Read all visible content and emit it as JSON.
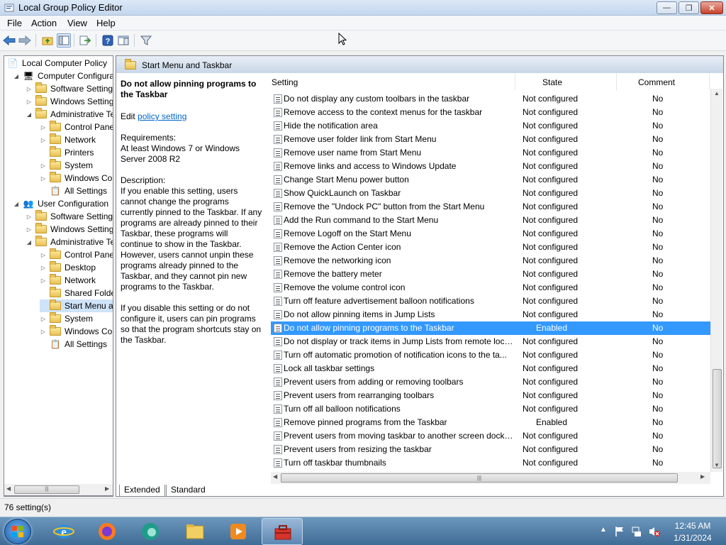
{
  "window": {
    "title": "Local Group Policy Editor"
  },
  "menu": [
    "File",
    "Action",
    "View",
    "Help"
  ],
  "tree": [
    {
      "label": "Local Computer Policy",
      "level": 0
    },
    {
      "label": "Computer Configura",
      "level": 1
    },
    {
      "label": "Software Settings",
      "level": 2
    },
    {
      "label": "Windows Setting",
      "level": 2
    },
    {
      "label": "Administrative Te",
      "level": 2
    },
    {
      "label": "Control Panel",
      "level": 3
    },
    {
      "label": "Network",
      "level": 3
    },
    {
      "label": "Printers",
      "level": 3
    },
    {
      "label": "System",
      "level": 3
    },
    {
      "label": "Windows Cor",
      "level": 3
    },
    {
      "label": "All Settings",
      "level": 3
    },
    {
      "label": "User Configuration",
      "level": 1
    },
    {
      "label": "Software Settings",
      "level": 2
    },
    {
      "label": "Windows Setting",
      "level": 2
    },
    {
      "label": "Administrative Te",
      "level": 2
    },
    {
      "label": "Control Panel",
      "level": 3
    },
    {
      "label": "Desktop",
      "level": 3
    },
    {
      "label": "Network",
      "level": 3
    },
    {
      "label": "Shared Folder",
      "level": 3
    },
    {
      "label": "Start Menu ar",
      "level": 3
    },
    {
      "label": "System",
      "level": 3
    },
    {
      "label": "Windows Cor",
      "level": 3
    },
    {
      "label": "All Settings",
      "level": 3
    }
  ],
  "main": {
    "header": "Start Menu and Taskbar",
    "description": {
      "title": "Do not allow pinning programs to the Taskbar",
      "edit_prefix": "Edit",
      "edit_link": "policy setting",
      "requirements_label": "Requirements:",
      "requirements": "At least Windows 7 or Windows Server 2008 R2",
      "description_label": "Description:",
      "p1": "If you enable this setting, users cannot change the programs currently pinned to the Taskbar. If any programs are already pinned to their Taskbar, these programs will continue to show in the Taskbar. However, users cannot unpin these programs already pinned to the Taskbar, and they cannot pin new programs to the Taskbar.",
      "p2": "If you disable this setting or do not configure it, users can pin programs so that the program shortcuts stay on the Taskbar."
    },
    "columns": {
      "setting": "Setting",
      "state": "State",
      "comment": "Comment"
    },
    "rows": [
      {
        "name": "Do not display any custom toolbars in the taskbar",
        "state": "Not configured",
        "comment": "No"
      },
      {
        "name": "Remove access to the context menus for the taskbar",
        "state": "Not configured",
        "comment": "No"
      },
      {
        "name": "Hide the notification area",
        "state": "Not configured",
        "comment": "No"
      },
      {
        "name": "Remove user folder link from Start Menu",
        "state": "Not configured",
        "comment": "No"
      },
      {
        "name": "Remove user name from Start Menu",
        "state": "Not configured",
        "comment": "No"
      },
      {
        "name": "Remove links and access to Windows Update",
        "state": "Not configured",
        "comment": "No"
      },
      {
        "name": "Change Start Menu power button",
        "state": "Not configured",
        "comment": "No"
      },
      {
        "name": "Show QuickLaunch on Taskbar",
        "state": "Not configured",
        "comment": "No"
      },
      {
        "name": "Remove the \"Undock PC\" button from the Start Menu",
        "state": "Not configured",
        "comment": "No"
      },
      {
        "name": "Add the Run command to the Start Menu",
        "state": "Not configured",
        "comment": "No"
      },
      {
        "name": "Remove Logoff on the Start Menu",
        "state": "Not configured",
        "comment": "No"
      },
      {
        "name": "Remove the Action Center icon",
        "state": "Not configured",
        "comment": "No"
      },
      {
        "name": "Remove the networking icon",
        "state": "Not configured",
        "comment": "No"
      },
      {
        "name": "Remove the battery meter",
        "state": "Not configured",
        "comment": "No"
      },
      {
        "name": "Remove the volume control icon",
        "state": "Not configured",
        "comment": "No"
      },
      {
        "name": "Turn off feature advertisement balloon notifications",
        "state": "Not configured",
        "comment": "No"
      },
      {
        "name": "Do not allow pinning items in Jump Lists",
        "state": "Not configured",
        "comment": "No"
      },
      {
        "name": "Do not allow pinning programs to the Taskbar",
        "state": "Enabled",
        "comment": "No"
      },
      {
        "name": "Do not display or track items in Jump Lists from remote loca...",
        "state": "Not configured",
        "comment": "No"
      },
      {
        "name": "Turn off automatic promotion of notification icons to the ta...",
        "state": "Not configured",
        "comment": "No"
      },
      {
        "name": "Lock all taskbar settings",
        "state": "Not configured",
        "comment": "No"
      },
      {
        "name": "Prevent users from adding or removing toolbars",
        "state": "Not configured",
        "comment": "No"
      },
      {
        "name": "Prevent users from rearranging toolbars",
        "state": "Not configured",
        "comment": "No"
      },
      {
        "name": "Turn off all balloon notifications",
        "state": "Not configured",
        "comment": "No"
      },
      {
        "name": "Remove pinned programs from the Taskbar",
        "state": "Enabled",
        "comment": "No"
      },
      {
        "name": "Prevent users from moving taskbar to another screen dock l...",
        "state": "Not configured",
        "comment": "No"
      },
      {
        "name": "Prevent users from resizing the taskbar",
        "state": "Not configured",
        "comment": "No"
      },
      {
        "name": "Turn off taskbar thumbnails",
        "state": "Not configured",
        "comment": "No"
      }
    ],
    "tabs": {
      "extended": "Extended",
      "standard": "Standard"
    }
  },
  "status": "76 setting(s)",
  "clock": {
    "time": "12:45 AM",
    "date": "1/31/2024"
  },
  "colors": {
    "selection": "#3399ff",
    "link": "#0066cc"
  }
}
